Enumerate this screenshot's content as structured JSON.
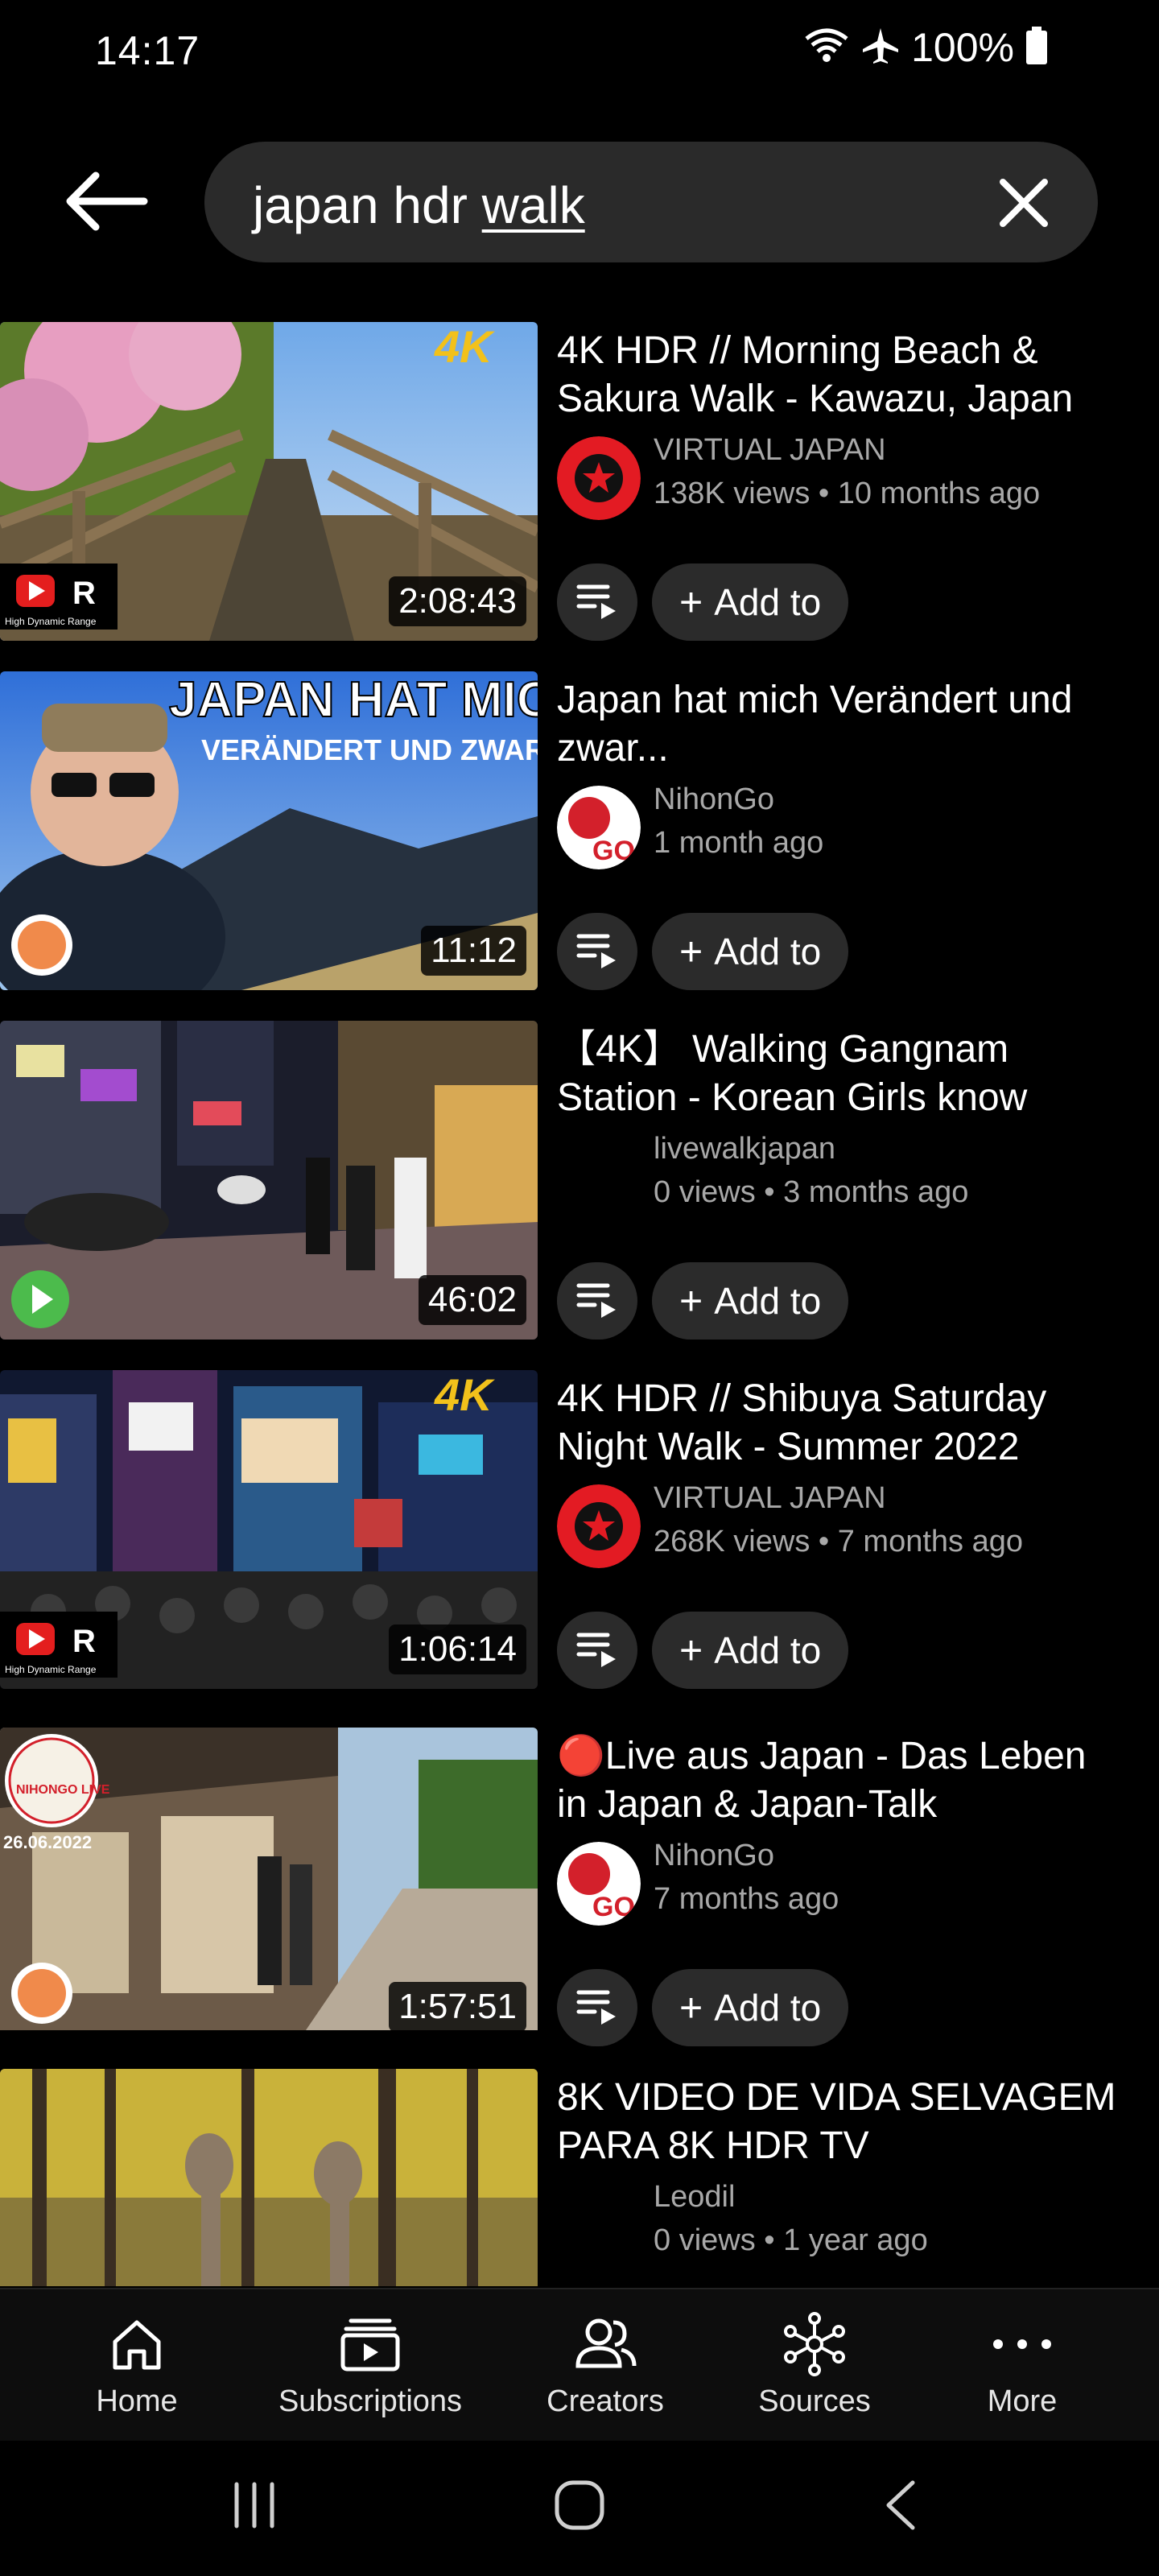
{
  "status_bar": {
    "time": "14:17",
    "battery": "100%"
  },
  "search": {
    "query_plain": "japan hdr ",
    "query_underlined": "walk"
  },
  "results": [
    {
      "title": "4K HDR // Morning Beach & Sakura Walk - Kawazu, Japan",
      "channel": "VIRTUAL JAPAN",
      "stats": "138K views • 10 months ago",
      "duration": "2:08:43",
      "badge_tl": "4K",
      "badge_bl": "HDR"
    },
    {
      "title": "Japan hat mich Verändert und zwar...",
      "channel": "NihonGo",
      "stats": "1 month ago",
      "duration": "11:12",
      "overlay_line1": "JAPAN HAT MICH",
      "overlay_line2": "VERÄNDERT UND ZWAR..."
    },
    {
      "title": "【4K】 Walking Gangnam Station - Korean Girls know",
      "channel": "livewalkjapan",
      "stats": "0 views • 3 months ago",
      "duration": "46:02"
    },
    {
      "title": "4K HDR // Shibuya Saturday Night Walk - Summer 2022",
      "channel": "VIRTUAL JAPAN",
      "stats": "268K views • 7 months ago",
      "duration": "1:06:14",
      "badge_tl": "4K",
      "badge_bl": "HDR"
    },
    {
      "title": "🔴Live aus Japan - Das Leben in Japan & Japan-Talk",
      "channel": "NihonGo",
      "stats": "7 months ago",
      "duration": "1:57:51",
      "overlay_line1": "NIHONGO LIVE",
      "overlay_line2": "26.06.2022"
    },
    {
      "title": "8K VIDEO DE VIDA SELVAGEM PARA 8K HDR TV",
      "channel": "Leodil",
      "stats": "0 views • 1 year ago",
      "duration": ""
    }
  ],
  "actions": {
    "add_to_label": "Add to"
  },
  "bottom_nav": [
    {
      "label": "Home",
      "icon": "home-icon"
    },
    {
      "label": "Subscriptions",
      "icon": "subscriptions-icon"
    },
    {
      "label": "Creators",
      "icon": "creators-icon"
    },
    {
      "label": "Sources",
      "icon": "sources-icon"
    },
    {
      "label": "More",
      "icon": "more-icon"
    }
  ],
  "colors": {
    "background": "#000000",
    "secondary_text": "#a8a8a8",
    "chip": "#2b2b2b",
    "search_bg": "#2a2a2a",
    "avatar_virtual_japan": "#e31b23"
  }
}
